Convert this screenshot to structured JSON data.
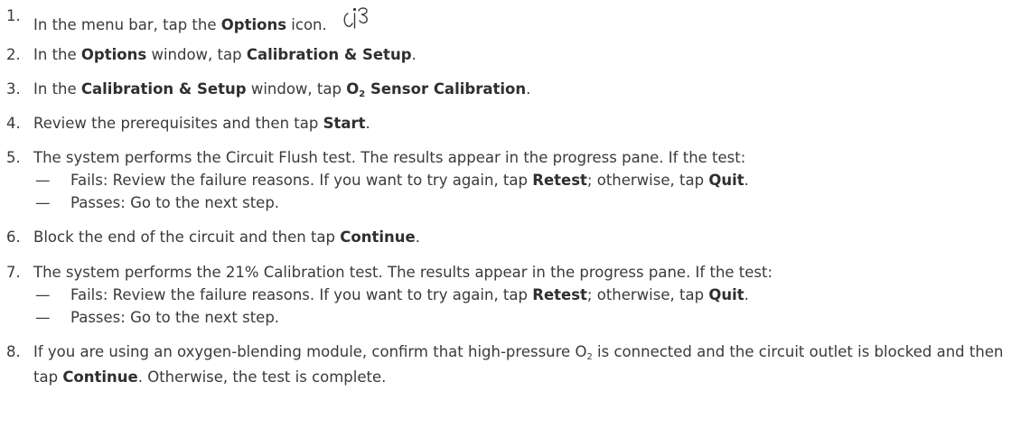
{
  "steps": [
    {
      "num": "1.",
      "parts": [
        {
          "t": "In the menu bar, tap the "
        },
        {
          "t": "Options",
          "b": true
        },
        {
          "t": " icon."
        }
      ],
      "icon": "options-icon"
    },
    {
      "num": "2.",
      "parts": [
        {
          "t": "In the "
        },
        {
          "t": "Options",
          "b": true
        },
        {
          "t": " window, tap "
        },
        {
          "t": "Calibration & Setup",
          "b": true
        },
        {
          "t": "."
        }
      ]
    },
    {
      "num": "3.",
      "parts": [
        {
          "t": "In the "
        },
        {
          "t": "Calibration & Setup",
          "b": true
        },
        {
          "t": " window, tap "
        },
        {
          "t": "O",
          "b": true
        },
        {
          "t": "2",
          "b": true,
          "sub": true
        },
        {
          "t": " Sensor Calibration",
          "b": true
        },
        {
          "t": "."
        }
      ]
    },
    {
      "num": "4.",
      "parts": [
        {
          "t": "Review the prerequisites and then tap "
        },
        {
          "t": "Start",
          "b": true
        },
        {
          "t": "."
        }
      ]
    },
    {
      "num": "5.",
      "parts": [
        {
          "t": "The system performs the Circuit Flush test. The results appear in the progress pane. If the test:"
        }
      ],
      "subs": [
        {
          "dash": "—",
          "parts": [
            {
              "t": "Fails: Review the failure reasons. If you want to try again, tap "
            },
            {
              "t": "Retest",
              "b": true
            },
            {
              "t": "; otherwise, tap "
            },
            {
              "t": "Quit",
              "b": true
            },
            {
              "t": "."
            }
          ]
        },
        {
          "dash": "—",
          "parts": [
            {
              "t": "Passes: Go to the next step."
            }
          ]
        }
      ]
    },
    {
      "num": "6.",
      "parts": [
        {
          "t": "Block the end of the circuit and then tap "
        },
        {
          "t": "Continue",
          "b": true
        },
        {
          "t": "."
        }
      ]
    },
    {
      "num": "7.",
      "parts": [
        {
          "t": "The system performs the 21% Calibration test. The results appear in the progress pane. If the test:"
        }
      ],
      "subs": [
        {
          "dash": "—",
          "parts": [
            {
              "t": "Fails: Review the failure reasons. If you want to try again, tap "
            },
            {
              "t": "Retest",
              "b": true
            },
            {
              "t": "; otherwise, tap "
            },
            {
              "t": "Quit",
              "b": true
            },
            {
              "t": "."
            }
          ]
        },
        {
          "dash": "—",
          "parts": [
            {
              "t": "Passes: Go to the next step."
            }
          ]
        }
      ]
    },
    {
      "num": "8.",
      "parts": [
        {
          "t": "If you are using an oxygen-blending module, confirm that high-pressure O"
        },
        {
          "t": "2",
          "sub": true
        },
        {
          "t": " is connected and the circuit outlet is blocked and then tap "
        },
        {
          "t": "Continue",
          "b": true
        },
        {
          "t": ". Otherwise, the test is complete."
        }
      ]
    }
  ]
}
